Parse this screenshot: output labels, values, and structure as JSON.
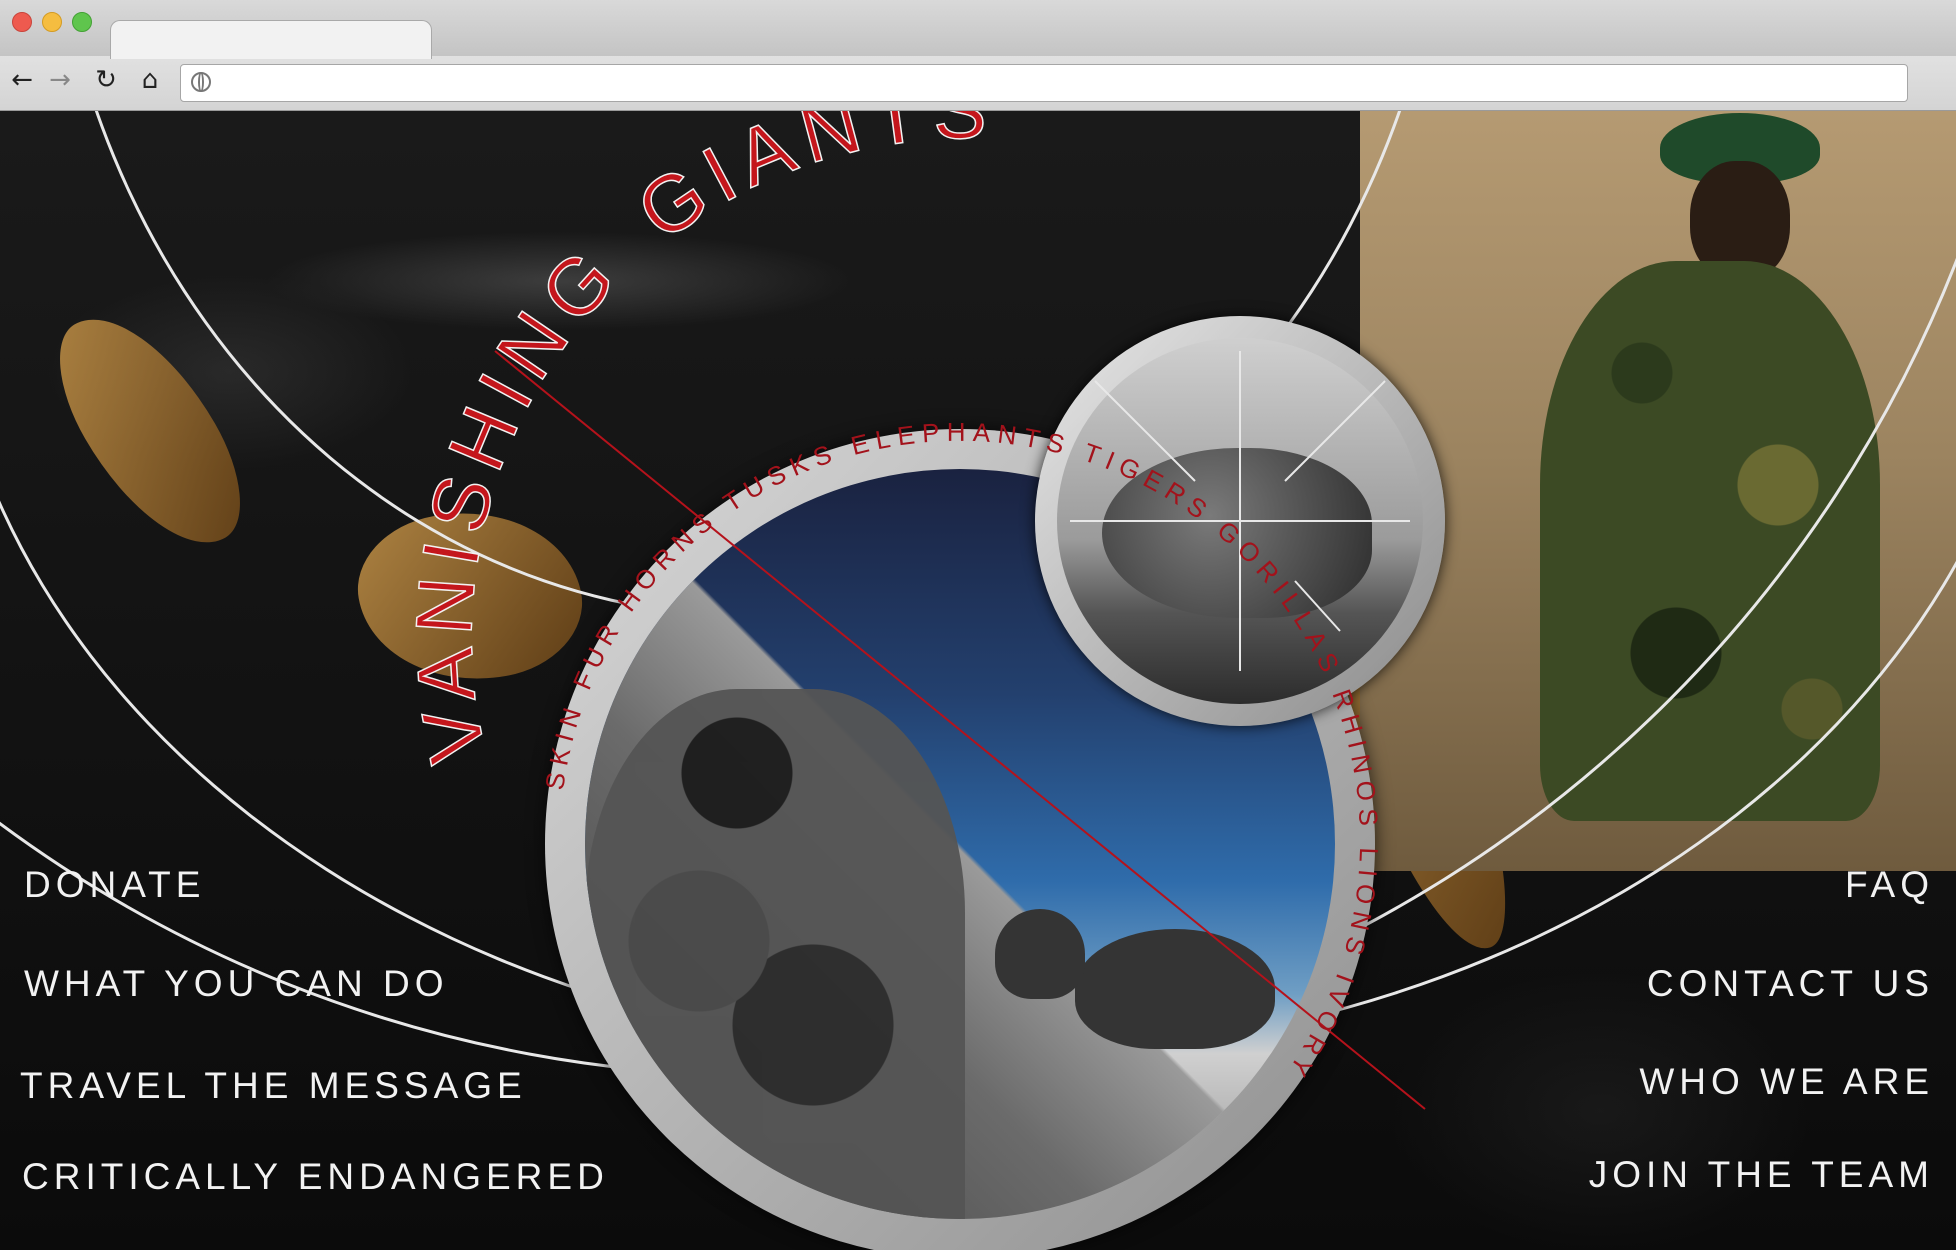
{
  "browser": {
    "url": "",
    "controls": [
      "back-icon",
      "forward-icon",
      "reload-icon",
      "home-icon"
    ]
  },
  "site": {
    "title_word1": "VANISHING",
    "title_word2": "GIANTS",
    "ring_words": [
      "SKIN",
      "FUR",
      "HORNS",
      "TUSKS",
      "ELEPHANTS",
      "TIGERS",
      "GORILLAS",
      "RHINOS",
      "LIONS",
      "IVORY"
    ]
  },
  "nav_left": [
    "DONATE",
    "WHAT YOU CAN DO",
    "TRAVEL THE MESSAGE",
    "CRITICALLY ENDANGERED"
  ],
  "nav_right": [
    "FAQ",
    "CONTACT US",
    "WHO WE ARE",
    "JOIN THE TEAM"
  ],
  "colors": {
    "accent_red": "#b5121b",
    "text": "#f2f2f2",
    "background": "#0d0d0d"
  }
}
